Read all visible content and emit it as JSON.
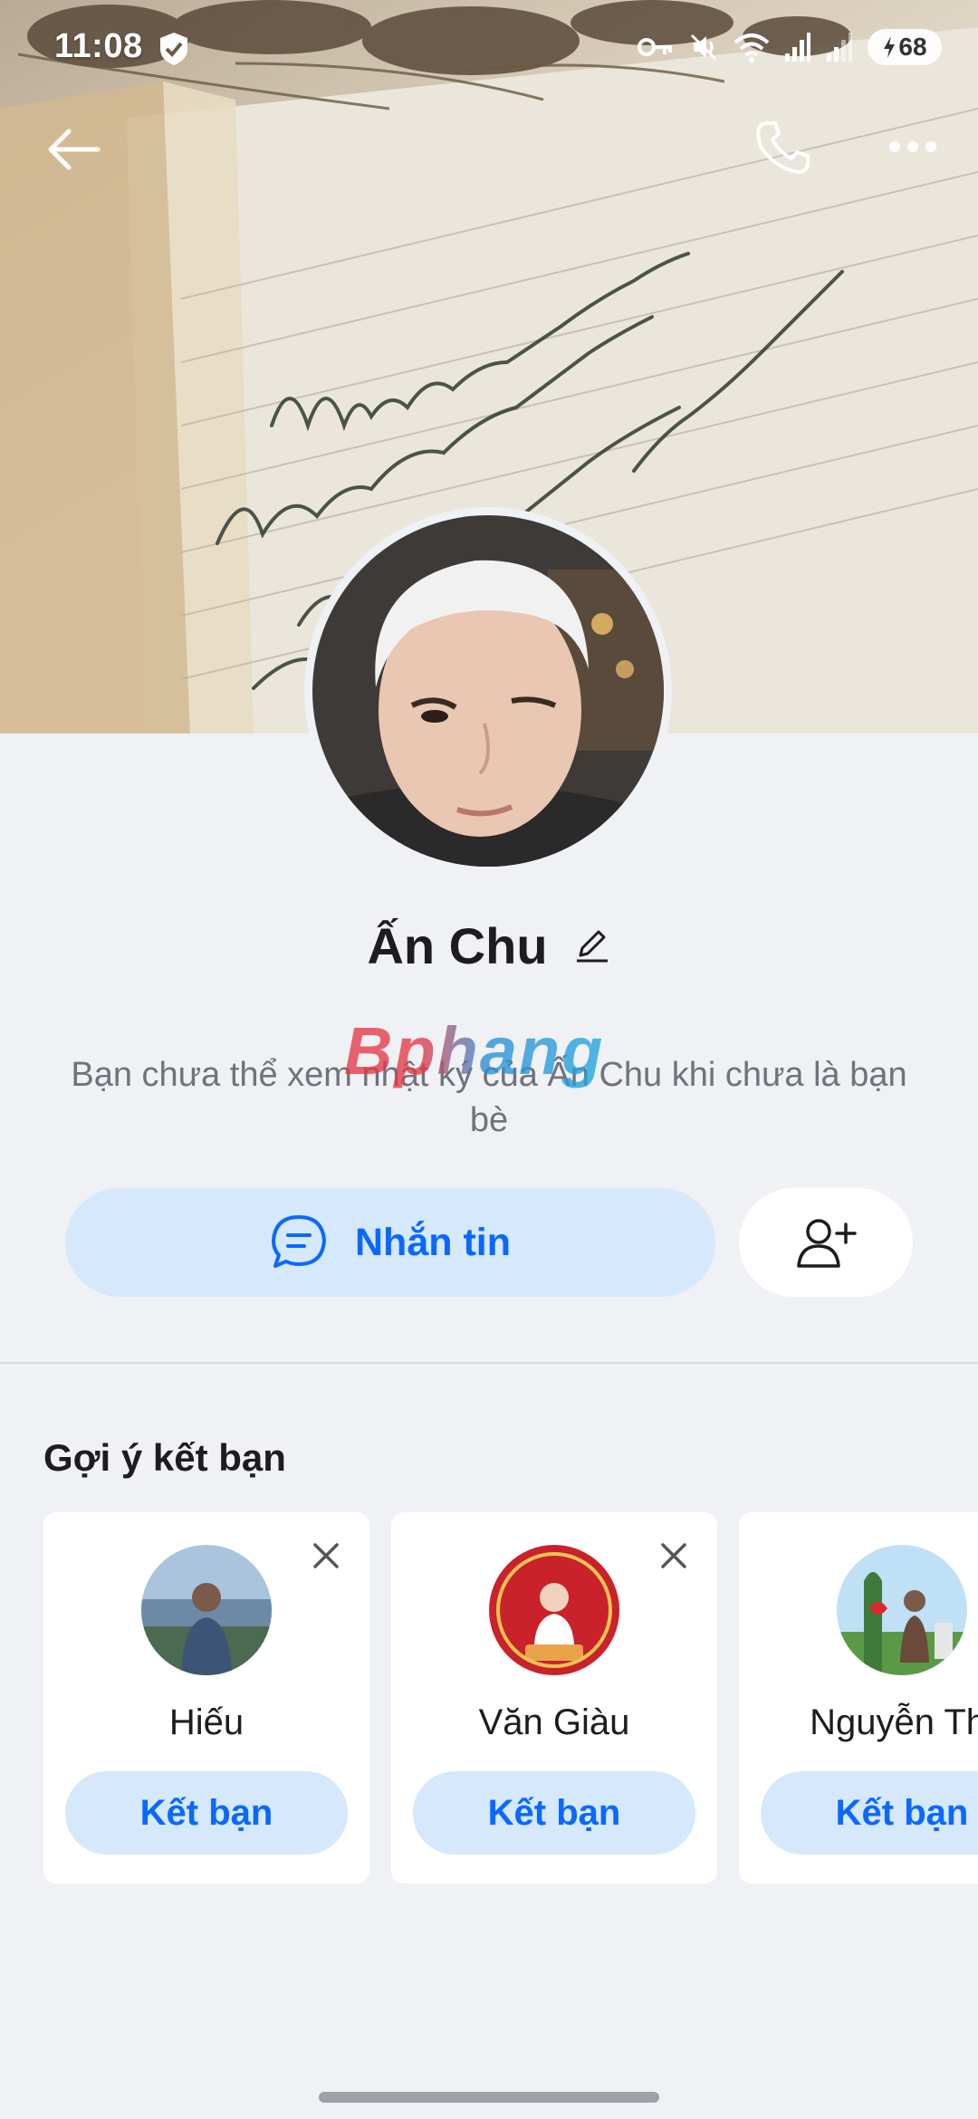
{
  "status_bar": {
    "time": "11:08",
    "battery": "68",
    "icons": [
      "shield-icon",
      "key-icon",
      "mute-icon",
      "wifi-icon",
      "signal-icon",
      "signal-icon",
      "battery-icon"
    ]
  },
  "header": {
    "back_icon": "back-arrow-icon",
    "call_icon": "phone-icon",
    "more_icon": "more-icon"
  },
  "profile": {
    "name": "Ấn Chu",
    "notice": "Bạn chưa thể xem nhật ký của Ấn Chu khi chưa là bạn bè",
    "watermark": "Bphang"
  },
  "actions": {
    "message_label": "Nhắn tin",
    "add_friend_icon": "add-friend-icon"
  },
  "suggestions": {
    "title": "Gợi ý kết bạn",
    "items": [
      {
        "name": "Hiếu",
        "button": "Kết bạn"
      },
      {
        "name": "Văn Giàu",
        "button": "Kết bạn"
      },
      {
        "name": "Nguyễn Thi",
        "button": "Kết bạn"
      }
    ]
  },
  "colors": {
    "accent": "#0a68ff",
    "button_bg": "#d6e8fc",
    "page_bg": "#eff1f5"
  }
}
